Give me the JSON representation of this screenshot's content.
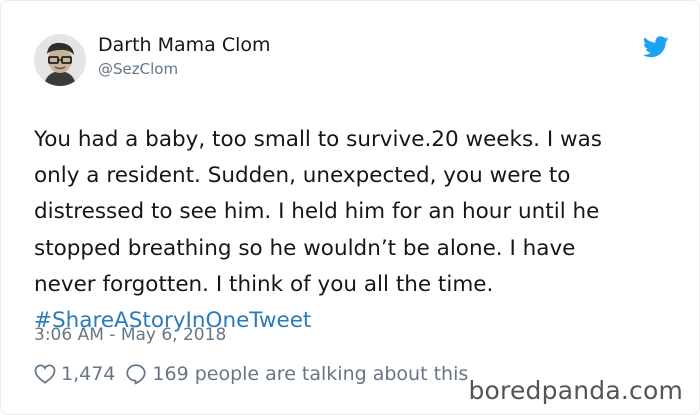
{
  "tweet": {
    "author": {
      "display_name": "Darth Mama Clom",
      "handle": "@SezClom",
      "avatar_icon": "avatar-illustration"
    },
    "brand_icon": "twitter-bird-icon",
    "brand_color": "#1da1f2",
    "text_lines": [
      "You had a baby, too small to survive.20 weeks. I was",
      "only a resident. Sudden, unexpected, you were to",
      "distressed to see him. I held him for an hour until he",
      "stopped breathing so he wouldn’t be alone. I have",
      "never forgotten. I think of you all the time."
    ],
    "hashtag": "#ShareAStoryInOneTweet",
    "hashtag_color": "#2b7bb9",
    "timestamp": "3:06 AM - May 6, 2018",
    "likes": {
      "icon": "heart-outline-icon",
      "count": "1,474"
    },
    "replies": {
      "icon": "speech-bubble-icon",
      "text": "169 people are talking about this"
    }
  },
  "watermark": "boredpanda.com"
}
